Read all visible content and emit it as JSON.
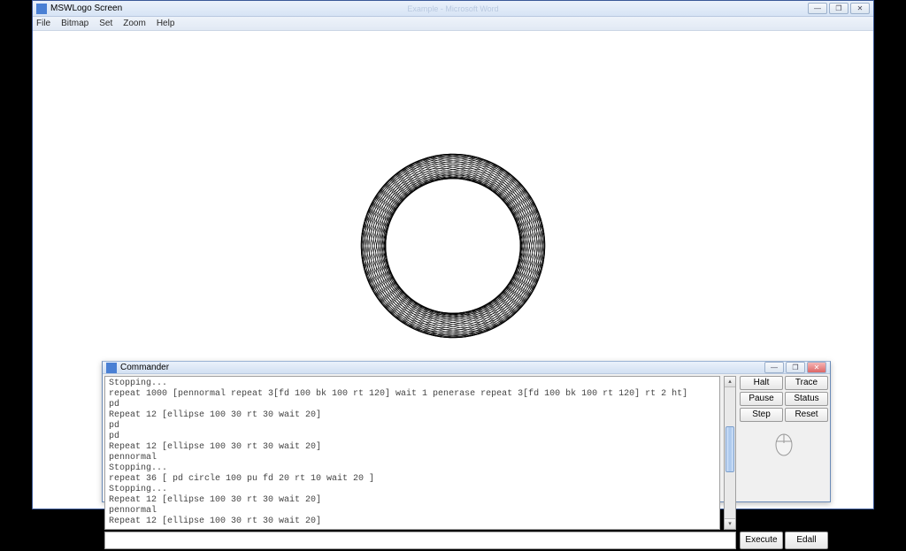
{
  "main_window": {
    "title": "MSWLogo Screen",
    "faded_center": "Example - Microsoft Word",
    "menu": {
      "file": "File",
      "bitmap": "Bitmap",
      "set": "Set",
      "zoom": "Zoom",
      "help": "Help"
    },
    "controls": {
      "min": "—",
      "max": "❐",
      "close": "✕"
    }
  },
  "commander": {
    "title": "Commander",
    "controls": {
      "min": "—",
      "max": "❐",
      "close": "✕"
    },
    "history": [
      "Stopping...",
      "repeat 1000 [pennormal repeat 3[fd 100 bk 100 rt 120] wait 1 penerase repeat 3[fd 100 bk 100 rt 120] rt 2 ht]",
      "pd",
      "Repeat 12 [ellipse 100 30 rt 30 wait 20]",
      "pd",
      "pd",
      "Repeat 12 [ellipse 100 30 rt 30 wait 20]",
      "pennormal",
      "Stopping...",
      "repeat 36 [ pd circle 100 pu fd 20 rt 10 wait 20 ]",
      "Stopping...",
      "Repeat 12 [ellipse 100 30 rt 30 wait 20]",
      "pennormal",
      "Repeat 12 [ellipse 100 30 rt 30 wait 20]"
    ],
    "input_value": "",
    "buttons": {
      "halt": "Halt",
      "trace": "Trace",
      "pause": "Pause",
      "status": "Status",
      "step": "Step",
      "reset": "Reset",
      "execute": "Execute",
      "edall": "Edall"
    }
  },
  "drawing": {
    "type": "rotated-circles",
    "count": 36,
    "circle_radius": 90,
    "offset": 14,
    "rotation_step_deg": 10
  }
}
